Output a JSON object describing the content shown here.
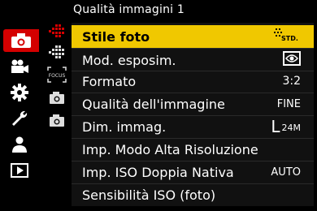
{
  "header": {
    "title": "Qualità immagini 1"
  },
  "left_tabs": [
    {
      "name": "photo-tab",
      "icon": "camera-icon",
      "active": true
    },
    {
      "name": "video-tab",
      "icon": "video-camera-icon",
      "active": false
    },
    {
      "name": "custom-tab",
      "icon": "gear-icon",
      "active": false
    },
    {
      "name": "setup-tab",
      "icon": "wrench-icon",
      "active": false
    },
    {
      "name": "mymenu-tab",
      "icon": "person-icon",
      "active": false
    },
    {
      "name": "playback-tab",
      "icon": "play-icon",
      "active": false
    }
  ],
  "sub_pages": [
    {
      "icon": "red-dots-arrow-icon"
    },
    {
      "icon": "dots-arrow-icon"
    },
    {
      "icon": "focus-icon",
      "text": "FOCUS"
    },
    {
      "icon": "camera-sub-icon-1"
    },
    {
      "icon": "camera-sub-icon-2"
    }
  ],
  "menu": {
    "items": [
      {
        "label": "Stile foto",
        "value": "STD.",
        "value_icon": "photo-style-icon"
      },
      {
        "label": "Mod. esposim.",
        "value": "",
        "value_icon": "metering-icon"
      },
      {
        "label": "Formato",
        "value": "3:2"
      },
      {
        "label": "Qualità dell'immagine",
        "value": "FINE"
      },
      {
        "label": "Dim. immag.",
        "value_large": "L",
        "value": "24M"
      },
      {
        "label": "Imp. Modo Alta Risoluzione",
        "value": ""
      },
      {
        "label": "Imp. ISO Doppia Nativa",
        "value": "AUTO"
      },
      {
        "label": "Sensibilità ISO (foto)",
        "value": ""
      }
    ]
  },
  "colors": {
    "accent": "#d40000",
    "highlight": "#f0c800"
  }
}
